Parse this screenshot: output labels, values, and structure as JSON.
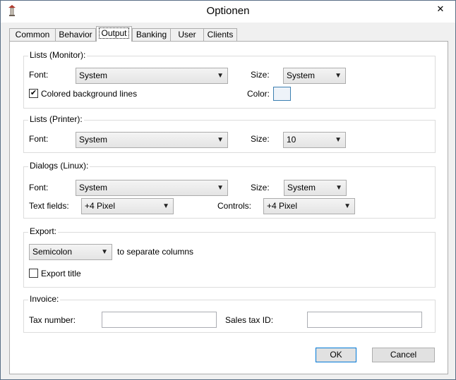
{
  "window": {
    "title": "Optionen",
    "close_glyph": "✕"
  },
  "tabs": [
    {
      "label": "Common"
    },
    {
      "label": "Behavior"
    },
    {
      "label": "Output"
    },
    {
      "label": "Banking"
    },
    {
      "label": "User"
    },
    {
      "label": "Clients"
    }
  ],
  "active_tab": "Output",
  "lists_monitor": {
    "title": "Lists (Monitor):",
    "font_label": "Font:",
    "font_value": "System",
    "size_label": "Size:",
    "size_value": "System",
    "colored_lines_label": "Colored background lines",
    "colored_lines_checked": true,
    "color_label": "Color:"
  },
  "lists_printer": {
    "title": "Lists (Printer):",
    "font_label": "Font:",
    "font_value": "System",
    "size_label": "Size:",
    "size_value": "10"
  },
  "dialogs": {
    "title": "Dialogs (Linux):",
    "font_label": "Font:",
    "font_value": "System",
    "size_label": "Size:",
    "size_value": "System",
    "textfields_label": "Text fields:",
    "textfields_value": "+4 Pixel",
    "controls_label": "Controls:",
    "controls_value": "+4 Pixel"
  },
  "export": {
    "title": "Export:",
    "separator_value": "Semicolon",
    "separator_suffix": "to separate columns",
    "export_title_label": "Export title",
    "export_title_checked": false
  },
  "invoice": {
    "title": "Invoice:",
    "tax_number_label": "Tax number:",
    "tax_number_value": "",
    "sales_tax_label": "Sales tax ID:",
    "sales_tax_value": ""
  },
  "buttons": {
    "ok": "OK",
    "cancel": "Cancel"
  },
  "glyphs": {
    "dropdown_arrow": "▼",
    "check": "✔"
  }
}
